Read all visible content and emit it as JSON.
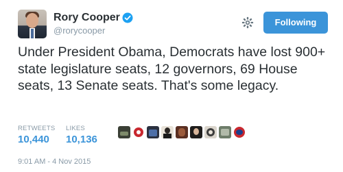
{
  "user": {
    "display_name": "Rory Cooper",
    "handle": "@rorycooper",
    "verified": true,
    "avatar_icon": "user-avatar-photo"
  },
  "actions": {
    "settings_icon": "gear-icon",
    "follow_label": "Following"
  },
  "tweet": {
    "text": "Under President Obama, Democrats have lost 900+ state legislature seats, 12 governors, 69 House seats, 13 Senate seats. That's some legacy."
  },
  "stats": {
    "retweets_label": "RETWEETS",
    "retweets_value": "10,440",
    "likes_label": "LIKES",
    "likes_value": "10,136"
  },
  "likers": {
    "count_shown": 9,
    "icon": "liker-avatar"
  },
  "timestamp": "9:01 AM - 4 Nov 2015",
  "colors": {
    "accent": "#3b94d9",
    "text": "#292f33",
    "muted": "#8899a6",
    "verified": "#1da1f2"
  }
}
